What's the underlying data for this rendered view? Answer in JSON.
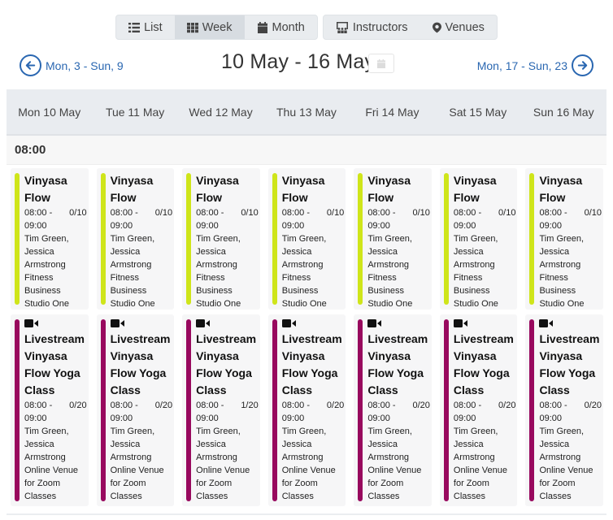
{
  "toolbar": {
    "views": [
      {
        "label": "List",
        "icon": "list-icon",
        "active": false
      },
      {
        "label": "Week",
        "icon": "grid-icon",
        "active": true
      },
      {
        "label": "Month",
        "icon": "calendar-icon",
        "active": false
      }
    ],
    "filters": [
      {
        "label": "Instructors",
        "icon": "instructors-icon"
      },
      {
        "label": "Venues",
        "icon": "map-marker-icon"
      }
    ]
  },
  "navigation": {
    "prev_label": "Mon, 3 - Sun, 9",
    "title": "10 May - 16 May",
    "next_label": "Mon, 17 - Sun, 23"
  },
  "colors": {
    "accent_blue": "#2a67b1",
    "vinyasa_bar": "#cfe51a",
    "livestream_bar": "#98095e"
  },
  "days": [
    "Mon 10 May",
    "Tue 11 May",
    "Wed 12 May",
    "Thu 13 May",
    "Fri 14 May",
    "Sat 15 May",
    "Sun 16 May"
  ],
  "time_slot": "08:00",
  "row1": [
    {
      "title": "Vinyasa Flow",
      "time_start": "08:00 -",
      "time_end": "09:00",
      "capacity": "0/10",
      "instructors": "Tim Green, Jessica Armstrong",
      "venue": "Fitness Business Studio One"
    },
    {
      "title": "Vinyasa Flow",
      "time_start": "08:00 -",
      "time_end": "09:00",
      "capacity": "0/10",
      "instructors": "Tim Green, Jessica Armstrong",
      "venue": "Fitness Business Studio One"
    },
    {
      "title": "Vinyasa Flow",
      "time_start": "08:00 -",
      "time_end": "09:00",
      "capacity": "0/10",
      "instructors": "Tim Green, Jessica Armstrong",
      "venue": "Fitness Business Studio One"
    },
    {
      "title": "Vinyasa Flow",
      "time_start": "08:00 -",
      "time_end": "09:00",
      "capacity": "0/10",
      "instructors": "Tim Green, Jessica Armstrong",
      "venue": "Fitness Business Studio One"
    },
    {
      "title": "Vinyasa Flow",
      "time_start": "08:00 -",
      "time_end": "09:00",
      "capacity": "0/10",
      "instructors": "Tim Green, Jessica Armstrong",
      "venue": "Fitness Business Studio One"
    },
    {
      "title": "Vinyasa Flow",
      "time_start": "08:00 -",
      "time_end": "09:00",
      "capacity": "0/10",
      "instructors": "Tim Green, Jessica Armstrong",
      "venue": "Fitness Business Studio One"
    },
    {
      "title": "Vinyasa Flow",
      "time_start": "08:00 -",
      "time_end": "09:00",
      "capacity": "0/10",
      "instructors": "Tim Green, Jessica Armstrong",
      "venue": "Fitness Business Studio One"
    }
  ],
  "row2": [
    {
      "title": "Livestream Vinyasa Flow Yoga Class",
      "time_start": "08:00 -",
      "time_end": "09:00",
      "capacity": "0/20",
      "instructors": "Tim Green, Jessica Armstrong",
      "venue": "Online Venue for Zoom Classes"
    },
    {
      "title": "Livestream Vinyasa Flow Yoga Class",
      "time_start": "08:00 -",
      "time_end": "09:00",
      "capacity": "0/20",
      "instructors": "Tim Green, Jessica Armstrong",
      "venue": "Online Venue for Zoom Classes"
    },
    {
      "title": "Livestream Vinyasa Flow Yoga Class",
      "time_start": "08:00 -",
      "time_end": "09:00",
      "capacity": "1/20",
      "instructors": "Tim Green, Jessica Armstrong",
      "venue": "Online Venue for Zoom Classes"
    },
    {
      "title": "Livestream Vinyasa Flow Yoga Class",
      "time_start": "08:00 -",
      "time_end": "09:00",
      "capacity": "0/20",
      "instructors": "Tim Green, Jessica Armstrong",
      "venue": "Online Venue for Zoom Classes"
    },
    {
      "title": "Livestream Vinyasa Flow Yoga Class",
      "time_start": "08:00 -",
      "time_end": "09:00",
      "capacity": "0/20",
      "instructors": "Tim Green, Jessica Armstrong",
      "venue": "Online Venue for Zoom Classes"
    },
    {
      "title": "Livestream Vinyasa Flow Yoga Class",
      "time_start": "08:00 -",
      "time_end": "09:00",
      "capacity": "0/20",
      "instructors": "Tim Green, Jessica Armstrong",
      "venue": "Online Venue for Zoom Classes"
    },
    {
      "title": "Livestream Vinyasa Flow Yoga Class",
      "time_start": "08:00 -",
      "time_end": "09:00",
      "capacity": "0/20",
      "instructors": "Tim Green, Jessica Armstrong",
      "venue": "Online Venue for Zoom Classes"
    }
  ]
}
